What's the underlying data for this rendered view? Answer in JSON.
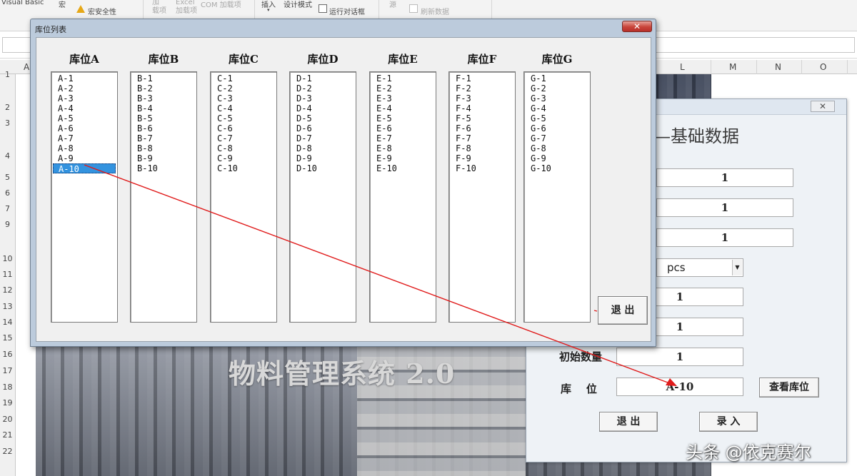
{
  "ribbon": {
    "visual_basic": "Visual Basic",
    "macro": "宏",
    "macro_security": "宏安全性",
    "addins": "加\n载项",
    "excel_addins": "Excel\n加载项",
    "com_addins": "COM 加载项",
    "insert": "插入",
    "design_mode": "设计模式",
    "run_dialog": "运行对话框",
    "source": "源",
    "refresh_data": "刷新数据"
  },
  "sheet": {
    "columns": [
      {
        "label": "A"
      },
      {
        "label": "L"
      },
      {
        "label": "M"
      },
      {
        "label": "N"
      },
      {
        "label": "O"
      }
    ],
    "rows": [
      {
        "label": "1"
      },
      {
        "label": "2"
      },
      {
        "label": "3"
      },
      {
        "label": "4"
      },
      {
        "label": "5"
      },
      {
        "label": "6"
      },
      {
        "label": "7"
      },
      {
        "label": "9"
      },
      {
        "label": "10"
      },
      {
        "label": "11"
      },
      {
        "label": "12"
      },
      {
        "label": "13"
      },
      {
        "label": "14"
      },
      {
        "label": "15"
      },
      {
        "label": "16"
      },
      {
        "label": "17"
      },
      {
        "label": "18"
      },
      {
        "label": "19"
      },
      {
        "label": "20"
      },
      {
        "label": "21"
      },
      {
        "label": "22"
      }
    ]
  },
  "background": {
    "system_title": "物料管理系统 2.0"
  },
  "form2": {
    "heading": "基础数据",
    "close_label": "✕",
    "field1_value": "1",
    "field2_value": "1",
    "field3_value": "1",
    "unit_value": "pcs",
    "field5_value": "1",
    "field6_value": "1",
    "initial_qty_label": "初始数量",
    "initial_qty_value": "1",
    "location_label": "库    位",
    "location_value": "A-10",
    "view_location_label": "查看库位",
    "exit_label": "退 出",
    "submit_label": "录 入"
  },
  "dialog": {
    "title": "库位列表",
    "close_label": "✕",
    "exit_label": "退 出",
    "columns": [
      {
        "header": "库位A",
        "items": [
          "A-1",
          "A-2",
          "A-3",
          "A-4",
          "A-5",
          "A-6",
          "A-7",
          "A-8",
          "A-9",
          "A-10"
        ]
      },
      {
        "header": "库位B",
        "items": [
          "B-1",
          "B-2",
          "B-3",
          "B-4",
          "B-5",
          "B-6",
          "B-7",
          "B-8",
          "B-9",
          "B-10"
        ]
      },
      {
        "header": "库位C",
        "items": [
          "C-1",
          "C-2",
          "C-3",
          "C-4",
          "C-5",
          "C-6",
          "C-7",
          "C-8",
          "C-9",
          "C-10"
        ]
      },
      {
        "header": "库位D",
        "items": [
          "D-1",
          "D-2",
          "D-3",
          "D-4",
          "D-5",
          "D-6",
          "D-7",
          "D-8",
          "D-9",
          "D-10"
        ]
      },
      {
        "header": "库位E",
        "items": [
          "E-1",
          "E-2",
          "E-3",
          "E-4",
          "E-5",
          "E-6",
          "E-7",
          "E-8",
          "E-9",
          "E-10"
        ]
      },
      {
        "header": "库位F",
        "items": [
          "F-1",
          "F-2",
          "F-3",
          "F-4",
          "F-5",
          "F-6",
          "F-7",
          "F-8",
          "F-9",
          "F-10"
        ]
      },
      {
        "header": "库位G",
        "items": [
          "G-1",
          "G-2",
          "G-3",
          "G-4",
          "G-5",
          "G-6",
          "G-7",
          "G-8",
          "G-9",
          "G-10"
        ]
      }
    ],
    "selected_item": "A-10"
  },
  "annotation": {
    "arrow_color": "#e01b1b"
  },
  "watermark": "头条 @依克赛尔"
}
